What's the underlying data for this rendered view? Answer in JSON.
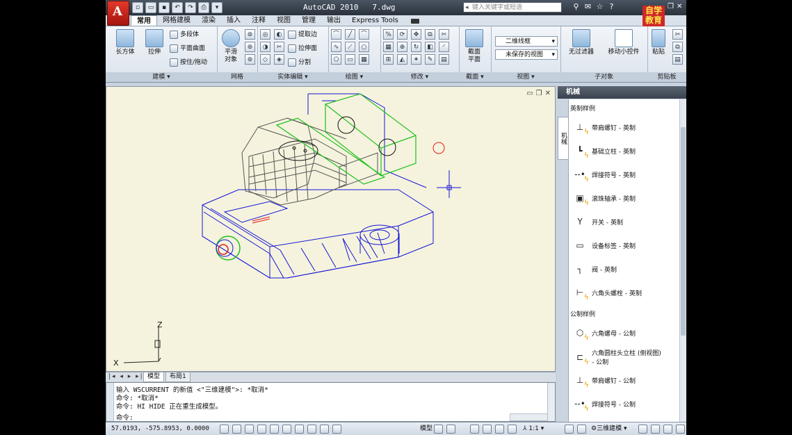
{
  "title": {
    "app_name": "AutoCAD 2010",
    "file": "7.dwg",
    "logo_letter": "A",
    "search_placeholder": "键入关键字或短语"
  },
  "watermark": {
    "line1": "自学",
    "line2": "教育"
  },
  "ribbon_tabs": [
    "常用",
    "网格建模",
    "渲染",
    "插入",
    "注释",
    "视图",
    "管理",
    "输出",
    "Express Tools"
  ],
  "ribbon_active_tab": "常用",
  "panels": {
    "modeling": {
      "title": "建模 ▾",
      "box": "长方体",
      "extrude": "拉伸",
      "polysolid": "多段体",
      "planar": "平面曲面",
      "presspull": "按住/拖动"
    },
    "mesh": {
      "title": "网格",
      "smooth": "平滑",
      "smooth2": "对象"
    },
    "solid_edit": {
      "title": "实体编辑 ▾",
      "extract": "提取边",
      "extrude_face": "拉伸面",
      "separate": "分割"
    },
    "draw": {
      "title": "绘图 ▾"
    },
    "modify": {
      "title": "修改 ▾"
    },
    "section": {
      "title": "截面 ▾",
      "plane": "截面",
      "plane2": "平面"
    },
    "view": {
      "title": "视图 ▾",
      "visual_style": "二维线框",
      "saved_view": "未保存的视图"
    },
    "subobject": {
      "title": "子对象",
      "filter": "无过滤器",
      "gizmo": "移动小控件"
    },
    "clipboard": {
      "title": "剪贴板",
      "paste": "粘贴"
    }
  },
  "layout_tabs": {
    "model": "模型",
    "layout1": "布局1"
  },
  "ucs": {
    "x": "X",
    "z": "Z"
  },
  "palette": {
    "title": "机械",
    "vertical_tab": "机械",
    "section_imperial": "英制样例",
    "section_metric": "公制样例",
    "items_imperial": [
      {
        "label": "带肩螺钉 - 英制",
        "icon": "shoulder-screw-icon"
      },
      {
        "label": "基础立柱 - 英制",
        "icon": "base-post-icon"
      },
      {
        "label": "焊接符号 - 英制",
        "icon": "weld-symbol-icon"
      },
      {
        "label": "滚珠轴承 - 英制",
        "icon": "ball-bearing-icon"
      },
      {
        "label": "开关 - 英制",
        "icon": "switch-icon"
      },
      {
        "label": "设备标签 - 英制",
        "icon": "equipment-tag-icon"
      },
      {
        "label": "阀 - 英制",
        "icon": "valve-icon"
      },
      {
        "label": "六角头螺栓 - 英制",
        "icon": "hex-bolt-icon"
      }
    ],
    "items_metric": [
      {
        "label": "六角螺母 - 公制",
        "icon": "hex-nut-icon"
      },
      {
        "label": "六角圆柱头立柱 (侧视图)",
        "label2": "- 公制",
        "icon": "hex-socket-post-icon"
      },
      {
        "label": "带肩螺钉 - 公制",
        "icon": "shoulder-screw-icon"
      },
      {
        "label": "焊接符号 - 公制",
        "icon": "weld-symbol-icon"
      }
    ]
  },
  "command": {
    "lines": [
      "输入 WSCURRENT 的新值 <\"三维建模\">: *取消*",
      "命令: *取消*",
      "命令: HI HIDE 正在重生成模型。",
      "命令:"
    ]
  },
  "status": {
    "coords": "57.0193,  -575.8953, 0.0000",
    "model": "模型",
    "scale": "1:1",
    "workspace": "三维建模"
  }
}
